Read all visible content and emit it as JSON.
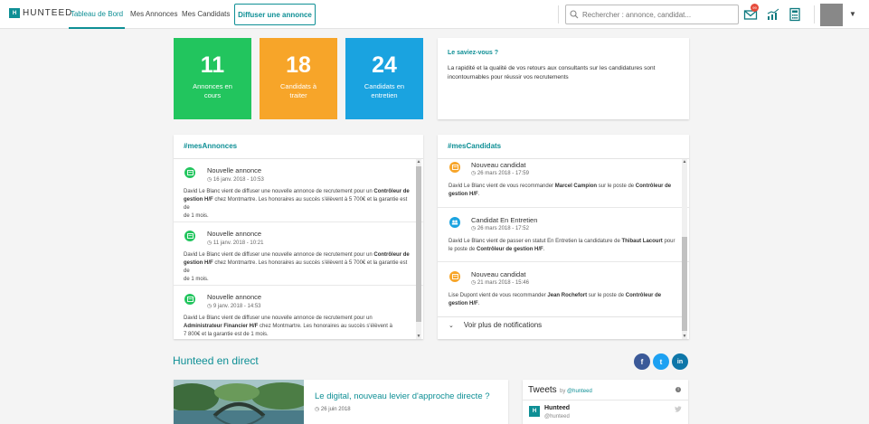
{
  "header": {
    "logo_mark": "H",
    "logo_text": "HUNTEED",
    "nav": [
      "Tableau de Bord",
      "Mes Annonces",
      "Mes Candidats"
    ],
    "cta": "Diffuser une annonce",
    "search_placeholder": "Rechercher : annonce, candidat...",
    "mail_badge": "99"
  },
  "stats": [
    {
      "value": "11",
      "label_lines": [
        "Annonces en",
        "cours"
      ],
      "color": "#22c55e"
    },
    {
      "value": "18",
      "label_lines": [
        "Candidats à",
        "traiter"
      ],
      "color": "#f7a529"
    },
    {
      "value": "24",
      "label_lines": [
        "Candidats en",
        "entretien"
      ],
      "color": "#1aa3e0"
    }
  ],
  "tip": {
    "title": "Le saviez-vous ?",
    "lines": [
      "La rapidité et la qualité de vos retours aux consultants sur les candidatures sont",
      "incontournables pour réussir vos recrutements"
    ]
  },
  "annonces": {
    "title": "#mesAnnonces",
    "items": [
      {
        "title": "Nouvelle annonce",
        "date": "16 janv. 2018 - 10:53",
        "line1_pre": "David Le Blanc vient de diffuser une nouvelle annonce de recrutement pour un ",
        "line1_b": "Contrôleur de",
        "line2_b": "gestion H/F",
        "line2_post": " chez Montmartre. Les honoraires au succès s'élèvent à 5 700€ et la garantie est de",
        "line3": "de 1 mois."
      },
      {
        "title": "Nouvelle annonce",
        "date": "11 janv. 2018 - 10:21",
        "line1_pre": "David Le Blanc vient de diffuser une nouvelle annonce de recrutement pour un ",
        "line1_b": "Contrôleur de",
        "line2_b": "gestion H/F",
        "line2_post": " chez Montmartre. Les honoraires au succès s'élèvent à 5 700€ et la garantie est de",
        "line3": "de 1 mois."
      },
      {
        "title": "Nouvelle annonce",
        "date": "9 janv. 2018 - 14:53",
        "line1_pre": "David Le Blanc vient de diffuser une nouvelle annonce de recrutement pour un",
        "line1_b": "",
        "line2_b": "Administrateur Financier H/F",
        "line2_post": " chez Montmartre. Les honoraires au succès s'élèvent à",
        "line3": "7 800€ et la garantie est de 1 mois."
      }
    ]
  },
  "candidats": {
    "title": "#mesCandidats",
    "items": [
      {
        "title": "Nouveau candidat",
        "date": "26 mars 2018 - 17:59",
        "l1_pre": "David Le Blanc vient de vous recommander ",
        "l1_b": "Marcel Campion",
        "l1_post": " sur le poste de ",
        "l1_b2": "Contrôleur de",
        "l2_b": "gestion H/F",
        "l2_post": "."
      },
      {
        "title": "Candidat En Entretien",
        "date": "26 mars 2018 - 17:52",
        "l1_pre": "David Le Blanc vient de passer en statut En Entretien la candidature de ",
        "l1_b": "Thibaut Lacourt",
        "l1_post": " pour",
        "l1_b2": "",
        "l2_pre": "le poste de ",
        "l2_b": "Contrôleur de gestion H/F",
        "l2_post": "."
      },
      {
        "title": "Nouveau candidat",
        "date": "21 mars 2018 - 15:46",
        "l1_pre": "Lise Dupont vient de vous recommander ",
        "l1_b": "Jean Rochefort",
        "l1_post": " sur le poste de ",
        "l1_b2": "Contrôleur de",
        "l2_b": "gestion H/F",
        "l2_post": "."
      }
    ],
    "more": "Voir plus de notifications"
  },
  "direct": {
    "title": "Hunteed en direct",
    "social": [
      "f",
      "t",
      "in"
    ],
    "article_title": "Le digital, nouveau levier d'approche directe ?",
    "article_date": "26 juin 2018"
  },
  "tweets": {
    "title": "Tweets",
    "by": "by ",
    "handle": "@hunteed",
    "user": "Hunteed",
    "user_handle": "@hunteed"
  },
  "colors": {
    "accent": "#0e8f95",
    "green": "#22c55e",
    "orange": "#f7a529",
    "blue": "#1aa3e0"
  }
}
